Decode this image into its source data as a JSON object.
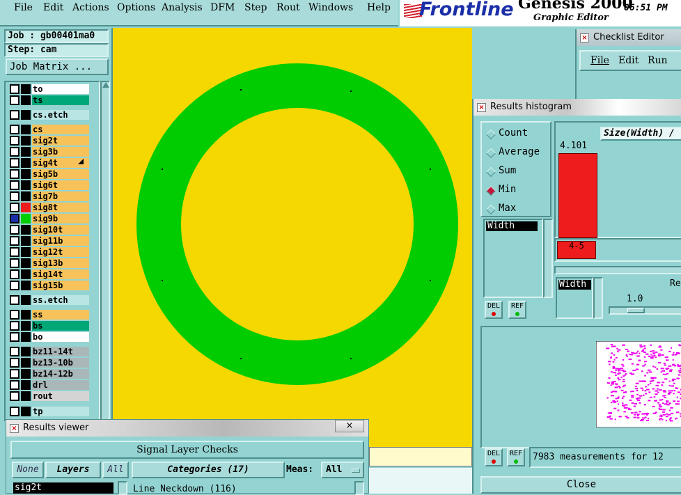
{
  "menubar": {
    "items": [
      "File",
      "Edit",
      "Actions",
      "Options",
      "Analysis",
      "DFM",
      "Step",
      "Rout",
      "Windows",
      "Help"
    ]
  },
  "logo": {
    "brand": "Frontline",
    "product": "Genesis 2000",
    "subtitle": "Graphic Editor",
    "time": "06:51 PM"
  },
  "job": {
    "job_label": "Job : gb00401ma0",
    "step_label": "Step: cam",
    "matrix_button": "Job Matrix ..."
  },
  "layers": [
    {
      "name": "to",
      "bg": "#ffffff",
      "swatch": "#000000"
    },
    {
      "name": "ts",
      "bg": "#00a878",
      "swatch": "#000000"
    },
    {
      "name": "cs.etch",
      "bg": "#b9e6e4",
      "swatch": "#000000"
    },
    {
      "name": "cs",
      "bg": "#f7c25a",
      "swatch": "#000000"
    },
    {
      "name": "sig2t",
      "bg": "#f7c25a",
      "swatch": "#000000"
    },
    {
      "name": "sig3b",
      "bg": "#f7c25a",
      "swatch": "#000000"
    },
    {
      "name": "sig4t",
      "bg": "#f7c25a",
      "swatch": "#000000"
    },
    {
      "name": "sig5b",
      "bg": "#f7c25a",
      "swatch": "#000000"
    },
    {
      "name": "sig6t",
      "bg": "#f7c25a",
      "swatch": "#000000"
    },
    {
      "name": "sig7b",
      "bg": "#f7c25a",
      "swatch": "#000000"
    },
    {
      "name": "sig8t",
      "bg": "#f7c25a",
      "swatch": "#ee1c1c"
    },
    {
      "name": "sig9b",
      "bg": "#f7c25a",
      "swatch": "#00cc00"
    },
    {
      "name": "sig10t",
      "bg": "#f7c25a",
      "swatch": "#000000"
    },
    {
      "name": "sig11b",
      "bg": "#f7c25a",
      "swatch": "#000000"
    },
    {
      "name": "sig12t",
      "bg": "#f7c25a",
      "swatch": "#000000"
    },
    {
      "name": "sig13b",
      "bg": "#f7c25a",
      "swatch": "#000000"
    },
    {
      "name": "sig14t",
      "bg": "#f7c25a",
      "swatch": "#000000"
    },
    {
      "name": "sig15b",
      "bg": "#f7c25a",
      "swatch": "#000000"
    },
    {
      "name": "ss.etch",
      "bg": "#b9e6e4",
      "swatch": "#000000"
    },
    {
      "name": "ss",
      "bg": "#f7c25a",
      "swatch": "#000000"
    },
    {
      "name": "bs",
      "bg": "#00a878",
      "swatch": "#000000"
    },
    {
      "name": "bo",
      "bg": "#ffffff",
      "swatch": "#000000"
    },
    {
      "name": "bz11-14t",
      "bg": "#a9b7b9",
      "swatch": "#000000"
    },
    {
      "name": "bz13-10b",
      "bg": "#a9b7b9",
      "swatch": "#000000"
    },
    {
      "name": "bz14-12b",
      "bg": "#a9b7b9",
      "swatch": "#000000"
    },
    {
      "name": "drl",
      "bg": "#a9b7b9",
      "swatch": "#000000"
    },
    {
      "name": "rout",
      "bg": "#d4d4d4",
      "swatch": "#000000"
    },
    {
      "name": "tp",
      "bg": "#b9e6e4",
      "swatch": "#000000"
    }
  ],
  "checklist": {
    "title": "Checklist Editor",
    "menu": [
      "File",
      "Edit",
      "Run"
    ]
  },
  "histogram": {
    "title": "Results histogram",
    "options": [
      "Count",
      "Average",
      "Sum",
      "Min",
      "Max"
    ],
    "selected": "Min",
    "list_item": "Width",
    "header": "Size(Width) /",
    "bar_value": "4.101",
    "bar_range": "4-5",
    "bar_fill": 1.0,
    "axis_list_item": "Width",
    "re_label": "Re",
    "scale_value": "1.0",
    "del_label": "DEL",
    "ref_label": "REF",
    "status": "7983 measurements for 12",
    "close_label": "Close"
  },
  "results_viewer": {
    "title": "Results viewer",
    "header": "Signal Layer Checks",
    "none_label": "None",
    "layers_label": "Layers",
    "all_label": "All",
    "categories_label": "Categories (17)",
    "meas_label": "Meas:",
    "meas_value": "All",
    "layer_selected": "sig2t",
    "category_item": "Line Neckdown (116)"
  },
  "colors": {
    "bg": "#93d4d2",
    "canvas": "#f5d800",
    "ring": "#00cc00",
    "bar": "#ee1c1c",
    "scatter": "#ee00ee"
  }
}
